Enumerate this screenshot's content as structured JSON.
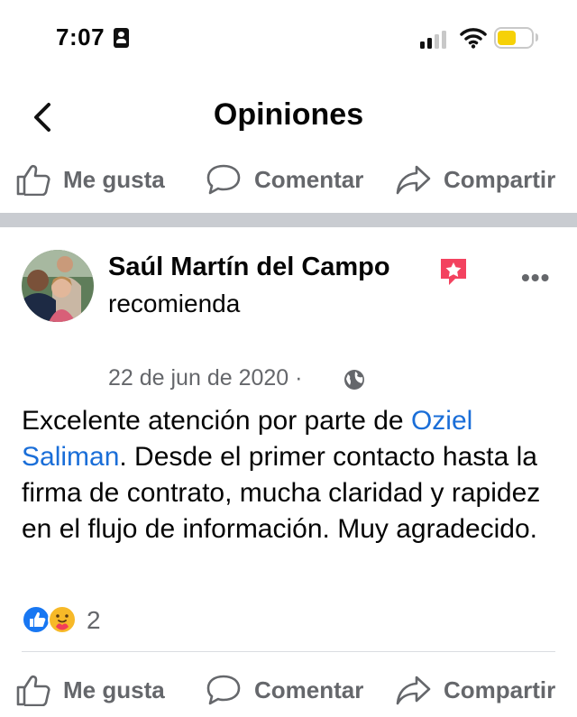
{
  "status_bar": {
    "time": "7:07"
  },
  "header": {
    "title": "Opiniones"
  },
  "actions": {
    "like_label": "Me gusta",
    "comment_label": "Comentar",
    "share_label": "Compartir"
  },
  "post": {
    "author": "Saúl Martín del Campo",
    "action": "recomienda",
    "date": "22 de jun de 2020 ·",
    "text_before_link": "Excelente atención por parte de ",
    "link_text": "Oziel Saliman",
    "text_after_link": ". Desde el primer contacto hasta la firma de contrato, mucha claridad y rapidez en el flujo de información. Muy agradecido.",
    "reaction_count": "2",
    "more_label": "•••"
  },
  "colors": {
    "accent_blue": "#1a6ed8",
    "muted": "#65676b",
    "badge": "#f3425f",
    "battery": "#f6d107"
  },
  "icons": [
    "person-icon",
    "signal-icon",
    "wifi-icon",
    "battery-icon",
    "back-chevron-icon",
    "thumbs-up-icon",
    "comment-icon",
    "share-icon",
    "recommend-badge-icon",
    "more-icon",
    "globe-icon",
    "like-reaction-icon",
    "care-reaction-icon"
  ]
}
